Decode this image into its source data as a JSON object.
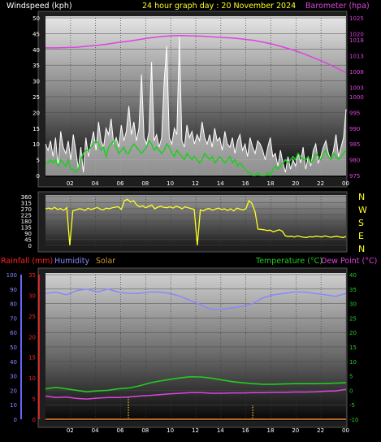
{
  "header": {
    "windspeed_label": "Windspeed (kph)",
    "graph_title": "24 hour graph day : 20 November 2024",
    "barometer_label": "Barometer (hpa)"
  },
  "middle": {
    "compass_labels": [
      "N",
      "W",
      "S",
      "E",
      "N"
    ]
  },
  "bottom_header": {
    "rainfall_label": "Rainfall (mm)",
    "humidity_label": "Humidity",
    "solar_label": "Solar",
    "temperature_label": "Temperature (°C)",
    "dewpoint_label": "Dew Point (°C)"
  },
  "colors": {
    "wind": "#ffffff",
    "gust_fill": "#ffffff",
    "avg_wind": "#22cc22",
    "barometer": "#dd44dd",
    "direction": "#ffff22",
    "rain": "#ff2222",
    "humidity": "#8888ff",
    "solar": "#cc9933",
    "temperature": "#22cc22",
    "dewpoint": "#dd44dd"
  },
  "chart_data": [
    {
      "type": "line",
      "title": "24 hour graph day : 20 November 2024",
      "x_ticks": [
        "02",
        "04",
        "06",
        "08",
        "10",
        "12",
        "14",
        "16",
        "18",
        "20",
        "22",
        "00"
      ],
      "left_axis": {
        "label": "Windspeed (kph)",
        "ticks": [
          0,
          5,
          10,
          15,
          20,
          25,
          30,
          35,
          40,
          45,
          50
        ],
        "ylim": [
          0,
          50
        ]
      },
      "right_axis": {
        "label": "Barometer (hpa)",
        "ticks": [
          975,
          980,
          985,
          990,
          995,
          1000,
          1003,
          1008,
          1013,
          1018,
          1020,
          1025
        ],
        "ylim": [
          975,
          1025
        ]
      },
      "series": [
        {
          "name": "Windspeed",
          "axis": "left",
          "values": [
            10,
            8,
            11,
            6,
            12,
            3,
            14,
            9,
            7,
            11,
            5,
            13,
            8,
            2,
            9,
            1,
            12,
            6,
            10,
            14,
            8,
            17,
            11,
            9,
            15,
            13,
            18,
            10,
            12,
            9,
            16,
            11,
            14,
            22,
            13,
            17,
            11,
            15,
            32,
            12,
            10,
            14,
            36,
            11,
            13,
            9,
            12,
            30,
            41,
            12,
            10,
            15,
            13,
            44,
            11,
            9,
            16,
            12,
            14,
            10,
            13,
            11,
            17,
            12,
            10,
            13,
            9,
            15,
            11,
            12,
            8,
            14,
            10,
            9,
            12,
            7,
            11,
            13,
            8,
            10,
            6,
            12,
            9,
            7,
            11,
            10,
            8,
            5,
            9,
            12,
            6,
            7,
            3,
            8,
            4,
            1,
            6,
            2,
            5,
            3,
            7,
            4,
            9,
            2,
            6,
            3,
            8,
            10,
            4,
            6,
            9,
            11,
            7,
            5,
            8,
            13,
            6,
            9,
            12,
            21
          ]
        },
        {
          "name": "Average wind",
          "axis": "left",
          "values": [
            4,
            4,
            5,
            4,
            5,
            3,
            5,
            4,
            3,
            5,
            2,
            2,
            1,
            2,
            5,
            7,
            8,
            8,
            9,
            10,
            11,
            10,
            8,
            9,
            6,
            9,
            10,
            11,
            9,
            7,
            8,
            9,
            7,
            7,
            9,
            10,
            9,
            8,
            7,
            8,
            9,
            11,
            10,
            8,
            9,
            8,
            7,
            8,
            10,
            9,
            7,
            6,
            8,
            7,
            6,
            5,
            7,
            6,
            5,
            6,
            5,
            4,
            5,
            7,
            6,
            5,
            6,
            4,
            5,
            6,
            5,
            4,
            5,
            6,
            4,
            5,
            3,
            4,
            3,
            2,
            1,
            1,
            0,
            0,
            1,
            0,
            0,
            0,
            1,
            0,
            2,
            3,
            2,
            3,
            4,
            5,
            4,
            5,
            6,
            5,
            7,
            6,
            5,
            5,
            6,
            4,
            5,
            7,
            6,
            5,
            7,
            8,
            6,
            5,
            7,
            6,
            5,
            6,
            7,
            8
          ]
        },
        {
          "name": "Barometer",
          "axis": "right",
          "values": [
            1015.5,
            1015.5,
            1015.6,
            1015.7,
            1016.0,
            1016.3,
            1016.7,
            1017.2,
            1017.6,
            1018.1,
            1018.6,
            1019.0,
            1019.3,
            1019.4,
            1019.3,
            1019.2,
            1019.0,
            1018.8,
            1018.6,
            1018.3,
            1017.9,
            1017.3,
            1016.6,
            1015.7,
            1014.7,
            1013.5,
            1012.2,
            1010.8,
            1009.3,
            1007.6
          ]
        }
      ]
    },
    {
      "type": "line",
      "x_ticks": [
        "02",
        "04",
        "06",
        "08",
        "10",
        "12",
        "14",
        "16",
        "18",
        "20",
        "22",
        "00"
      ],
      "left_axis": {
        "ticks": [
          0,
          45,
          90,
          135,
          180,
          225,
          270,
          315,
          360
        ],
        "ylim": [
          0,
          360
        ]
      },
      "right_axis": {
        "ticks": [
          "N",
          "W",
          "S",
          "E",
          "N"
        ]
      },
      "series": [
        {
          "name": "Wind direction",
          "values": [
            270,
            275,
            268,
            280,
            265,
            272,
            260,
            278,
            0,
            255,
            262,
            270,
            268,
            258,
            275,
            265,
            272,
            280,
            268,
            262,
            275,
            270,
            278,
            282,
            285,
            265,
            330,
            340,
            320,
            330,
            300,
            285,
            292,
            278,
            288,
            298,
            270,
            282,
            290,
            280,
            278,
            285,
            275,
            288,
            282,
            270,
            285,
            278,
            272,
            265,
            0,
            262,
            255,
            268,
            272,
            260,
            268,
            275,
            265,
            270,
            258,
            270,
            255,
            275,
            268,
            262,
            270,
            330,
            310,
            250,
            120,
            118,
            115,
            110,
            112,
            100,
            108,
            115,
            105,
            70,
            65,
            68,
            62,
            70,
            65,
            60,
            58,
            64,
            62,
            68,
            66,
            62,
            70,
            65,
            60,
            64,
            68,
            62,
            58,
            66
          ]
        }
      ]
    },
    {
      "type": "line",
      "x_ticks": [
        "02",
        "04",
        "06",
        "08",
        "10",
        "12",
        "14",
        "16",
        "18",
        "20",
        "22",
        "00"
      ],
      "left_axes": [
        {
          "label": "Humidity",
          "ticks": [
            0,
            10,
            20,
            30,
            40,
            50,
            60,
            70,
            80,
            90,
            100
          ],
          "ylim": [
            0,
            100
          ]
        },
        {
          "label": "Rainfall (mm)",
          "ticks": [
            0,
            5,
            10,
            15,
            20,
            25,
            30,
            35
          ],
          "ylim": [
            0,
            35
          ]
        }
      ],
      "right_axis": {
        "label": "Temperature (°C)",
        "ticks": [
          -10,
          -5,
          0,
          5,
          10,
          15,
          20,
          25,
          30,
          35,
          40
        ],
        "ylim": [
          -10,
          40
        ]
      },
      "series": [
        {
          "name": "Humidity",
          "axis": "humidity",
          "values": [
            87,
            88,
            86,
            89,
            90,
            88,
            90,
            88,
            87,
            87,
            88,
            88,
            87,
            85,
            82,
            79,
            76,
            76,
            77,
            78,
            80,
            84,
            86,
            87,
            88,
            88,
            87,
            86,
            85,
            87
          ]
        },
        {
          "name": "Temperature",
          "axis": "right",
          "values": [
            0.5,
            1,
            0.5,
            0,
            -0.5,
            -0.2,
            0,
            0.5,
            0.8,
            1.5,
            2.5,
            3.2,
            3.8,
            4.3,
            4.7,
            4.6,
            4.2,
            3.6,
            3.0,
            2.6,
            2.3,
            2.1,
            2.1,
            2.2,
            2.3,
            2.3,
            2.3,
            2.4,
            2.5,
            2.6
          ]
        },
        {
          "name": "Dew Point",
          "axis": "right",
          "values": [
            -2,
            -2.5,
            -2.3,
            -2.8,
            -3,
            -2.7,
            -2.5,
            -2.5,
            -2.3,
            -2,
            -1.8,
            -1.5,
            -1.2,
            -1,
            -0.8,
            -0.8,
            -1,
            -1,
            -0.9,
            -0.9,
            -0.8,
            -0.8,
            -0.7,
            -0.7,
            -0.6,
            -0.6,
            -0.5,
            -0.3,
            -0.2,
            0.3
          ]
        },
        {
          "name": "Rainfall",
          "axis": "rainfall",
          "values": [
            0,
            0,
            0,
            0,
            0,
            0,
            0,
            0,
            0,
            0,
            0,
            0,
            0,
            0,
            0,
            0,
            0,
            0,
            0,
            0,
            0,
            0,
            0,
            0,
            0,
            0,
            0,
            0,
            0,
            0
          ]
        },
        {
          "name": "Solar",
          "axis": "humidity",
          "values": [
            0,
            0,
            0,
            0,
            0,
            0,
            0,
            0,
            6,
            0,
            0,
            0,
            0,
            0,
            0,
            0,
            0,
            0,
            0,
            0,
            4,
            0,
            0,
            0,
            0,
            0,
            0,
            0,
            0,
            0
          ]
        }
      ]
    }
  ]
}
